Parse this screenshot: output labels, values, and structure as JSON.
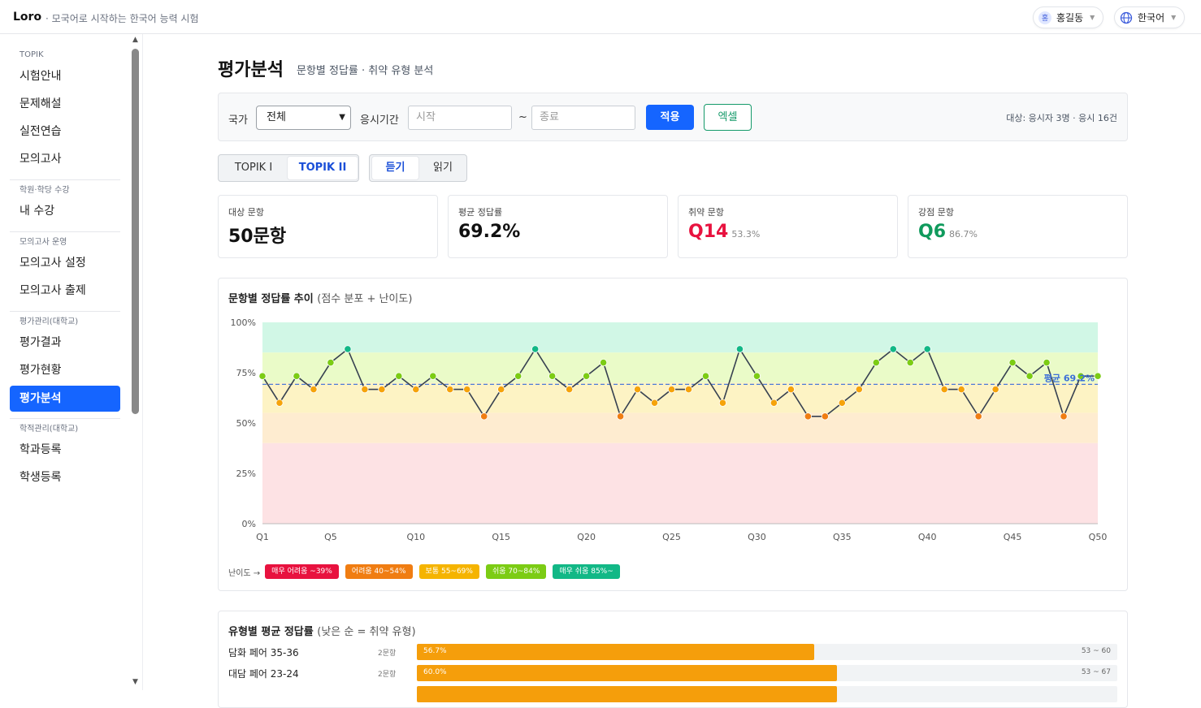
{
  "header": {
    "brand": "Loro",
    "tagline": "모국어로 시작하는 한국어 능력 시험",
    "user": {
      "avatar": "홍",
      "name": "홍길동"
    },
    "language": "한국어"
  },
  "sidebar": {
    "sections": [
      {
        "title": "TOPIK",
        "items": [
          "시험안내",
          "문제해설",
          "실전연습",
          "모의고사"
        ]
      },
      {
        "title": "학원·학당 수강",
        "items": [
          "내 수강"
        ]
      },
      {
        "title": "모의고사 운영",
        "items": [
          "모의고사 설정",
          "모의고사 출제"
        ]
      },
      {
        "title": "평가관리(대학교)",
        "items": [
          "평가결과",
          "평가현황",
          "평가분석"
        ]
      },
      {
        "title": "학적관리(대학교)",
        "items": [
          "학과등록",
          "학생등록"
        ]
      }
    ],
    "active": "평가분석"
  },
  "page": {
    "title": "평가분석",
    "subtitle": "문항별 정답률 · 취약 유형 분석"
  },
  "filter": {
    "country_label": "국가",
    "country_value": "전체",
    "period_label": "응시기간",
    "start_placeholder": "시작",
    "tilde": "~",
    "end_placeholder": "종료",
    "apply": "적용",
    "excel": "엑셀",
    "summary": "대상: 응시자 3명 · 응시 16건"
  },
  "level_tabs": [
    "TOPIK I",
    "TOPIK II"
  ],
  "level_active": "TOPIK II",
  "section_tabs": [
    "듣기",
    "읽기"
  ],
  "section_active": "듣기",
  "cards": [
    {
      "label": "대상 문항",
      "value": "50문항",
      "sub": "",
      "color": "#111111"
    },
    {
      "label": "평균 정답률",
      "value": "69.2%",
      "sub": "",
      "color": "#111111"
    },
    {
      "label": "취약 문항",
      "value": "Q14",
      "sub": "53.3%",
      "color": "#e8123f"
    },
    {
      "label": "강점 문항",
      "value": "Q6",
      "sub": "86.7%",
      "color": "#0f9a5c"
    }
  ],
  "chart_panel": {
    "title": "문항별 정답률 추이",
    "title_note": "(점수 분포 + 난이도)"
  },
  "chart_data": {
    "type": "line",
    "y_ticks": [
      "100%",
      "75%",
      "50%",
      "25%",
      "0%"
    ],
    "ylim": [
      0,
      100
    ],
    "x_ticks": [
      "Q1",
      "Q5",
      "Q10",
      "Q15",
      "Q20",
      "Q25",
      "Q30",
      "Q35",
      "Q40",
      "Q45",
      "Q50"
    ],
    "x_tick_values": [
      1,
      5,
      10,
      15,
      20,
      25,
      30,
      35,
      40,
      45,
      50
    ],
    "x": [
      1,
      2,
      3,
      4,
      5,
      6,
      7,
      8,
      9,
      10,
      11,
      12,
      13,
      14,
      15,
      16,
      17,
      18,
      19,
      20,
      21,
      22,
      23,
      24,
      25,
      26,
      27,
      28,
      29,
      30,
      31,
      32,
      33,
      34,
      35,
      36,
      37,
      38,
      39,
      40,
      41,
      42,
      43,
      44,
      45,
      46,
      47,
      48,
      49,
      50
    ],
    "values": [
      73.3,
      60.0,
      73.3,
      66.7,
      80.0,
      86.7,
      66.7,
      66.7,
      73.3,
      66.7,
      73.3,
      66.7,
      66.7,
      53.3,
      66.7,
      73.3,
      86.7,
      73.3,
      66.7,
      73.3,
      80.0,
      53.3,
      66.7,
      60.0,
      66.7,
      66.7,
      73.3,
      60.0,
      86.7,
      73.3,
      60.0,
      66.7,
      53.3,
      53.3,
      60.0,
      66.7,
      80.0,
      86.7,
      80.0,
      86.7,
      66.7,
      66.7,
      53.3,
      66.7,
      80.0,
      73.3,
      80.0,
      53.3,
      73.3,
      73.3
    ],
    "average": 69.2,
    "average_label": "평균 69.2%",
    "bands": [
      {
        "from": 85,
        "to": 100,
        "color": "#d1f7e6"
      },
      {
        "from": 70,
        "to": 85,
        "color": "#eafbc8"
      },
      {
        "from": 55,
        "to": 70,
        "color": "#fdf3c4"
      },
      {
        "from": 40,
        "to": 55,
        "color": "#feecd0"
      },
      {
        "from": 0,
        "to": 40,
        "color": "#fde2e4"
      }
    ],
    "grid": false
  },
  "legend": {
    "label": "난이도 →",
    "items": [
      {
        "text": "매우 어려움 ~39%",
        "color": "#e8123f"
      },
      {
        "text": "어려움 40~54%",
        "color": "#f07d12"
      },
      {
        "text": "보통 55~69%",
        "color": "#f5b400"
      },
      {
        "text": "쉬움 70~84%",
        "color": "#7ccc14"
      },
      {
        "text": "매우 쉬움 85%~",
        "color": "#12b886"
      }
    ]
  },
  "type_panel": {
    "title": "유형별 평균 정답률",
    "title_note": "(낮은 순 = 취약 유형)"
  },
  "type_rows": [
    {
      "name": "담화 페어 35-36",
      "count": "2문항",
      "pct": "56.7%",
      "value": 56.7,
      "range": "53 ~ 60"
    },
    {
      "name": "대담 페어 23-24",
      "count": "2문항",
      "pct": "60.0%",
      "value": 60.0,
      "range": "53 ~ 67"
    },
    {
      "name": "",
      "count": "",
      "pct": "",
      "value": 60.0,
      "range": ""
    }
  ]
}
